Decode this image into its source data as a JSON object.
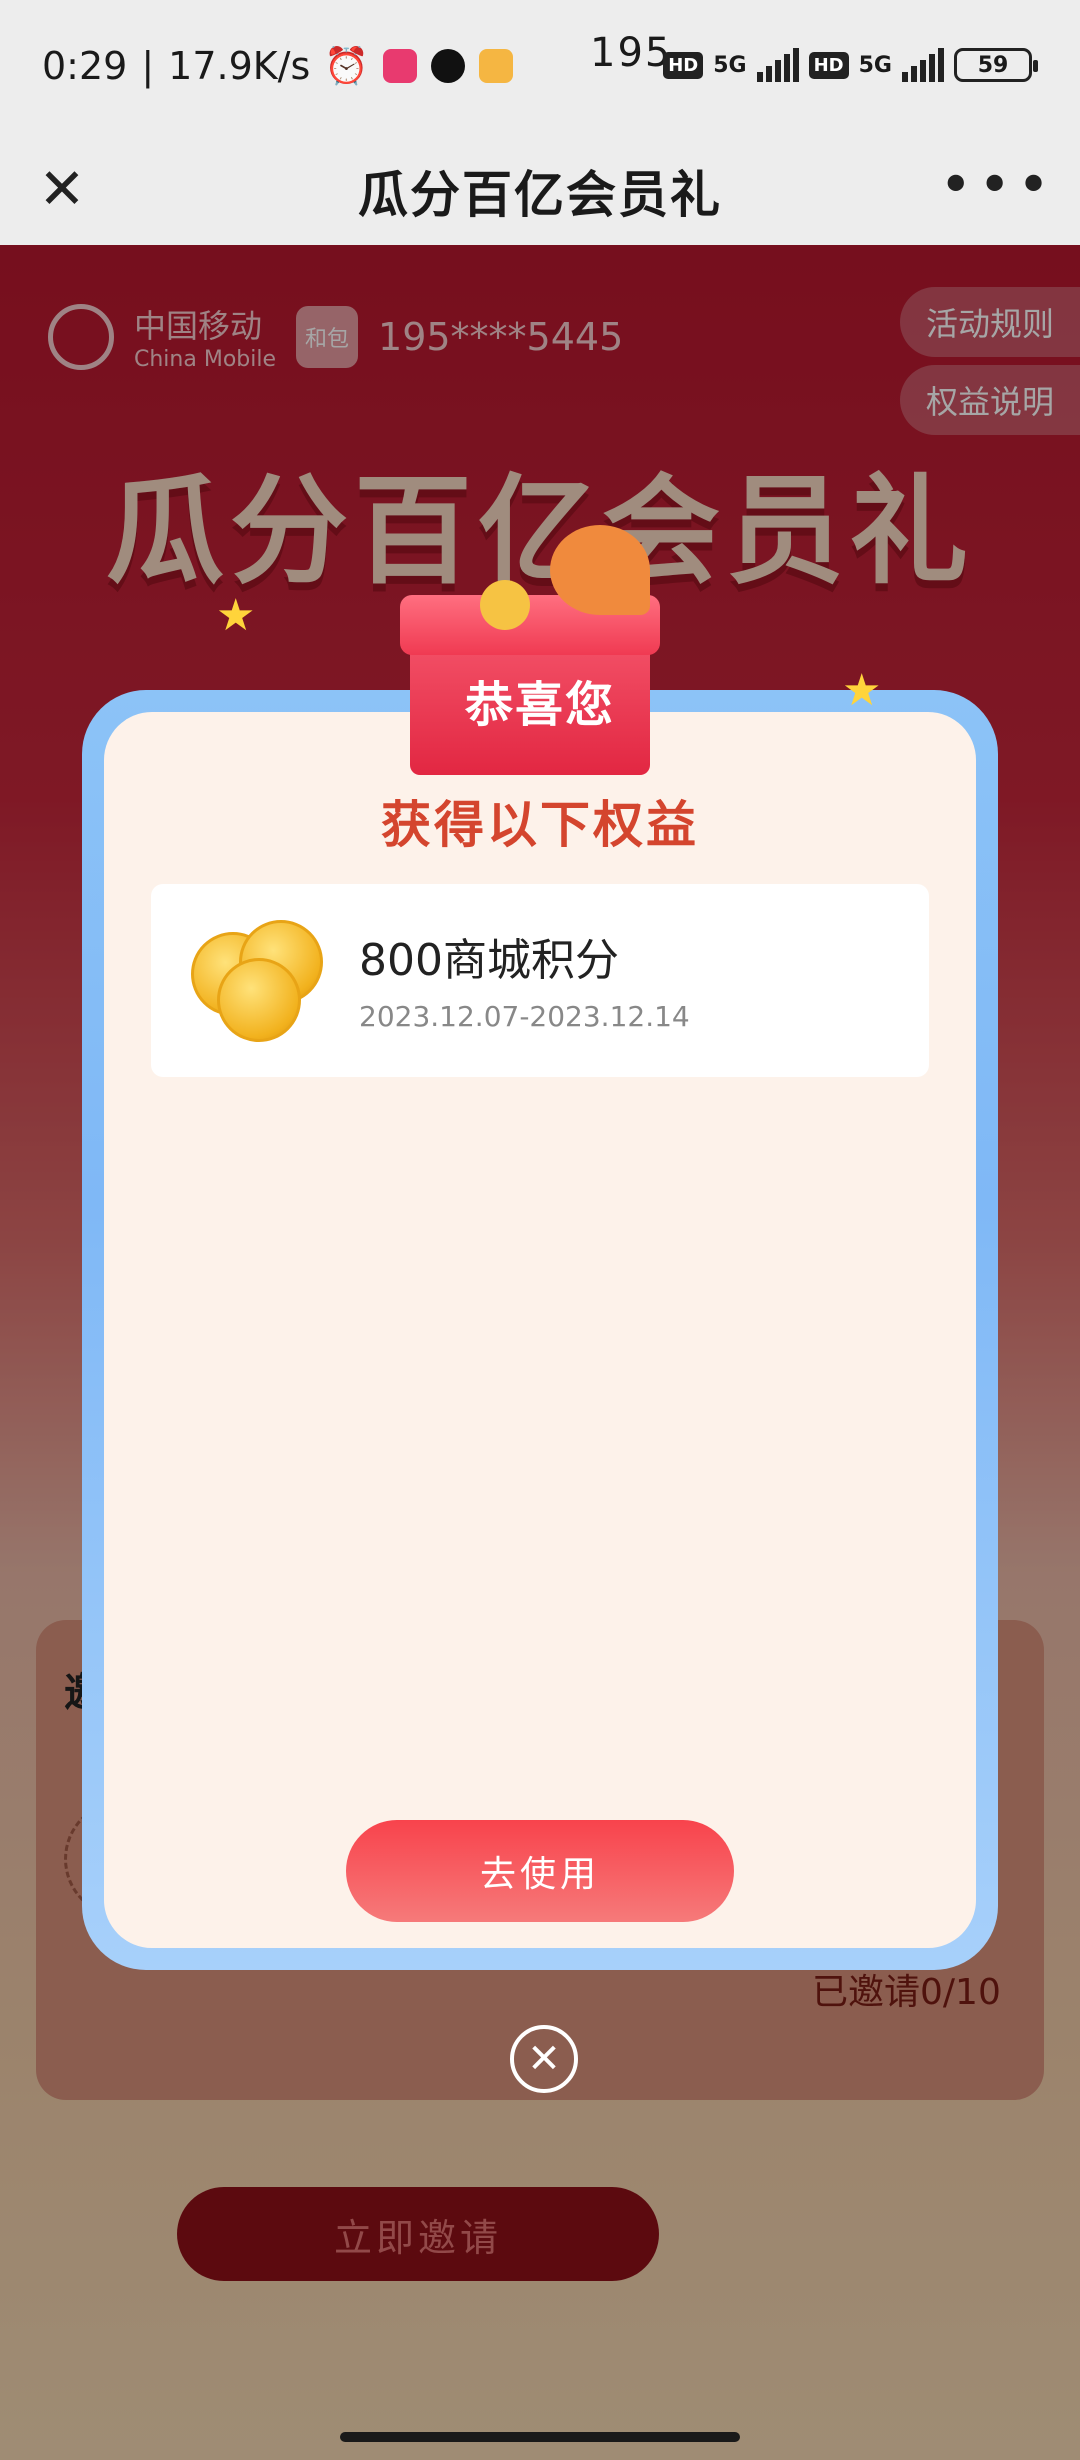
{
  "status_bar": {
    "time": "0:29",
    "net_speed": "17.9K/s",
    "center_text": "195",
    "network_label": "5G",
    "hd_label": "HD",
    "battery": "59"
  },
  "titlebar": {
    "title": "瓜分百亿会员礼"
  },
  "background_page": {
    "brand_zh": "中国移动",
    "brand_en": "China Mobile",
    "hebao_label": "和包",
    "phone": "195****5445",
    "rules_button": "活动规则",
    "benefit_desc_button": "权益说明",
    "big_title": "瓜分百亿会员礼",
    "invite_title": "邀",
    "invited_count": "已邀请0/10",
    "invite_button": "立即邀请"
  },
  "modal": {
    "congrats": "恭喜您",
    "subtitle": "获得以下权益",
    "benefit_name": "800商城积分",
    "benefit_date": "2023.12.07-2023.12.14",
    "use_button": "去使用"
  }
}
